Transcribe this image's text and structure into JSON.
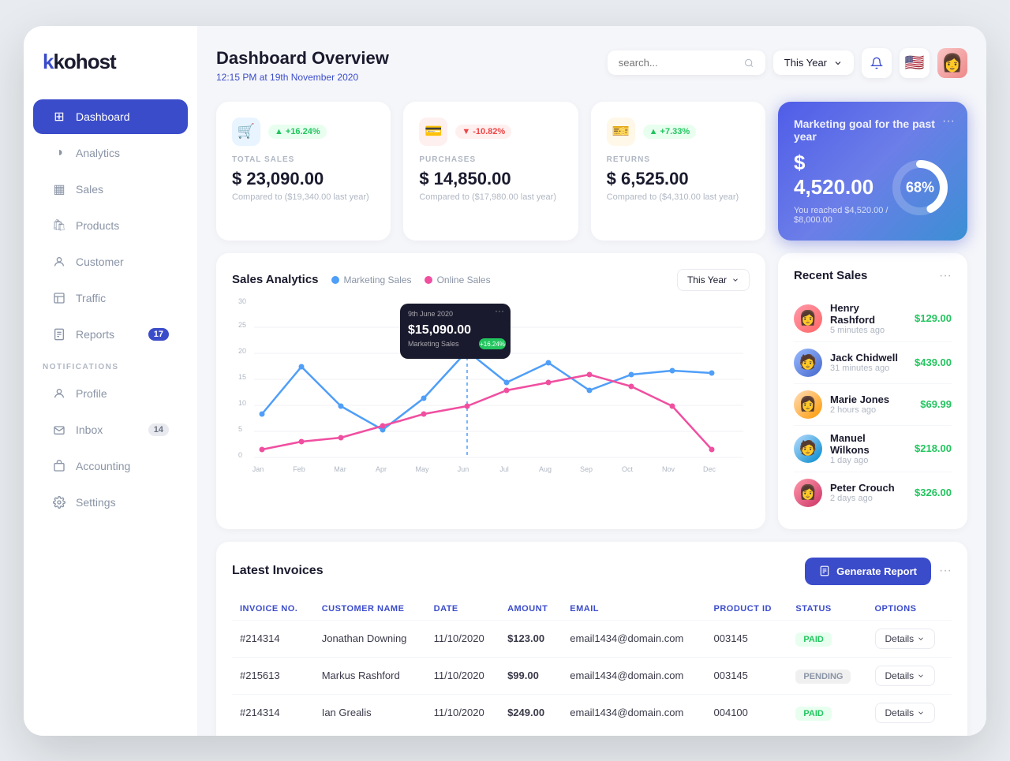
{
  "app": {
    "logo": "kohost",
    "logo_dot": "·"
  },
  "sidebar": {
    "nav_items": [
      {
        "id": "dashboard",
        "label": "Dashboard",
        "icon": "⊞",
        "active": true,
        "badge": null
      },
      {
        "id": "analytics",
        "label": "Analytics",
        "icon": "◑",
        "active": false,
        "badge": null
      },
      {
        "id": "sales",
        "label": "Sales",
        "icon": "▦",
        "active": false,
        "badge": null
      },
      {
        "id": "products",
        "label": "Products",
        "icon": "🛍",
        "active": false,
        "badge": null
      },
      {
        "id": "customer",
        "label": "Customer",
        "icon": "👤",
        "active": false,
        "badge": null
      },
      {
        "id": "traffic",
        "label": "Traffic",
        "icon": "⊿",
        "active": false,
        "badge": null
      },
      {
        "id": "reports",
        "label": "Reports",
        "icon": "📄",
        "active": false,
        "badge": "17"
      },
      {
        "id": "notifications",
        "label": "NOTIFICATIONS",
        "type": "section",
        "icon": null
      },
      {
        "id": "profile",
        "label": "Profile",
        "icon": "👤",
        "active": false,
        "badge": null
      },
      {
        "id": "inbox",
        "label": "Inbox",
        "icon": "✉",
        "active": false,
        "badge": "14"
      },
      {
        "id": "accounting",
        "label": "Accounting",
        "icon": "💼",
        "active": false,
        "badge": null
      },
      {
        "id": "settings",
        "label": "Settings",
        "icon": "⚙",
        "active": false,
        "badge": null
      }
    ]
  },
  "header": {
    "title": "Dashboard Overview",
    "subtitle": "12:15 PM at 19th November 2020",
    "search_placeholder": "search...",
    "year_filter": "This Year"
  },
  "stats": [
    {
      "id": "total-sales",
      "icon": "🛒",
      "icon_type": "blue",
      "badge": "+16.24%",
      "badge_type": "green",
      "label": "TOTAL SALES",
      "value": "$ 23,090.00",
      "compare": "Compared to ($19,340.00 last year)"
    },
    {
      "id": "purchases",
      "icon": "💳",
      "icon_type": "red",
      "badge": "-10.82%",
      "badge_type": "red",
      "label": "PURCHASES",
      "value": "$ 14,850.00",
      "compare": "Compared to ($17,980.00 last year)"
    },
    {
      "id": "returns",
      "icon": "🎫",
      "icon_type": "orange",
      "badge": "+7.33%",
      "badge_type": "green",
      "label": "RETURNS",
      "value": "$ 6,525.00",
      "compare": "Compared to ($4,310.00 last year)"
    }
  ],
  "marketing_goal": {
    "title": "Marketing goal for the past year",
    "value": "$ 4,520.00",
    "percent": "68%",
    "percent_num": 68,
    "footer": "You reached $4,520.00 / $8,000.00"
  },
  "chart": {
    "title": "Sales Analytics",
    "legend": [
      {
        "label": "Marketing Sales",
        "color": "blue"
      },
      {
        "label": "Online Sales",
        "color": "pink"
      }
    ],
    "year_filter": "This Year",
    "tooltip": {
      "date": "9th June 2020",
      "value": "$15,090.00",
      "label": "Marketing Sales",
      "badge": "+16.24%"
    },
    "x_labels": [
      "Jan",
      "Feb",
      "Mar",
      "Apr",
      "May",
      "Jun",
      "Jul",
      "Aug",
      "Sep",
      "Oct",
      "Nov",
      "Dec"
    ],
    "y_labels": [
      "0",
      "5",
      "10",
      "15",
      "20",
      "25",
      "30"
    ]
  },
  "recent_sales": {
    "title": "Recent Sales",
    "items": [
      {
        "name": "Henry Rashford",
        "time": "5 minutes ago",
        "amount": "$129.00",
        "avatar": "av1",
        "emoji": "👩"
      },
      {
        "name": "Jack Chidwell",
        "time": "31 minutes ago",
        "amount": "$439.00",
        "avatar": "av2",
        "emoji": "🧑"
      },
      {
        "name": "Marie Jones",
        "time": "2 hours ago",
        "amount": "$69.99",
        "avatar": "av3",
        "emoji": "👩"
      },
      {
        "name": "Manuel Wilkons",
        "time": "1 day ago",
        "amount": "$218.00",
        "avatar": "av4",
        "emoji": "🧑"
      },
      {
        "name": "Peter Crouch",
        "time": "2 days ago",
        "amount": "$326.00",
        "avatar": "av5",
        "emoji": "👩"
      }
    ]
  },
  "invoices": {
    "title": "Latest Invoices",
    "generate_btn": "Generate Report",
    "columns": [
      "Invoice No.",
      "Customer Name",
      "Date",
      "Amount",
      "Email",
      "Product ID",
      "Status",
      "Options"
    ],
    "rows": [
      {
        "invoice": "#214314",
        "customer": "Jonathan Downing",
        "date": "11/10/2020",
        "amount": "$123.00",
        "email": "email1434@domain.com",
        "product_id": "003145",
        "status": "PAID",
        "status_type": "paid"
      },
      {
        "invoice": "#215613",
        "customer": "Markus Rashford",
        "date": "11/10/2020",
        "amount": "$99.00",
        "email": "email1434@domain.com",
        "product_id": "003145",
        "status": "PENDING",
        "status_type": "pending"
      },
      {
        "invoice": "#214314",
        "customer": "Ian Grealis",
        "date": "11/10/2020",
        "amount": "$249.00",
        "email": "email1434@domain.com",
        "product_id": "004100",
        "status": "PAID",
        "status_type": "paid"
      }
    ],
    "details_btn": "Details"
  }
}
